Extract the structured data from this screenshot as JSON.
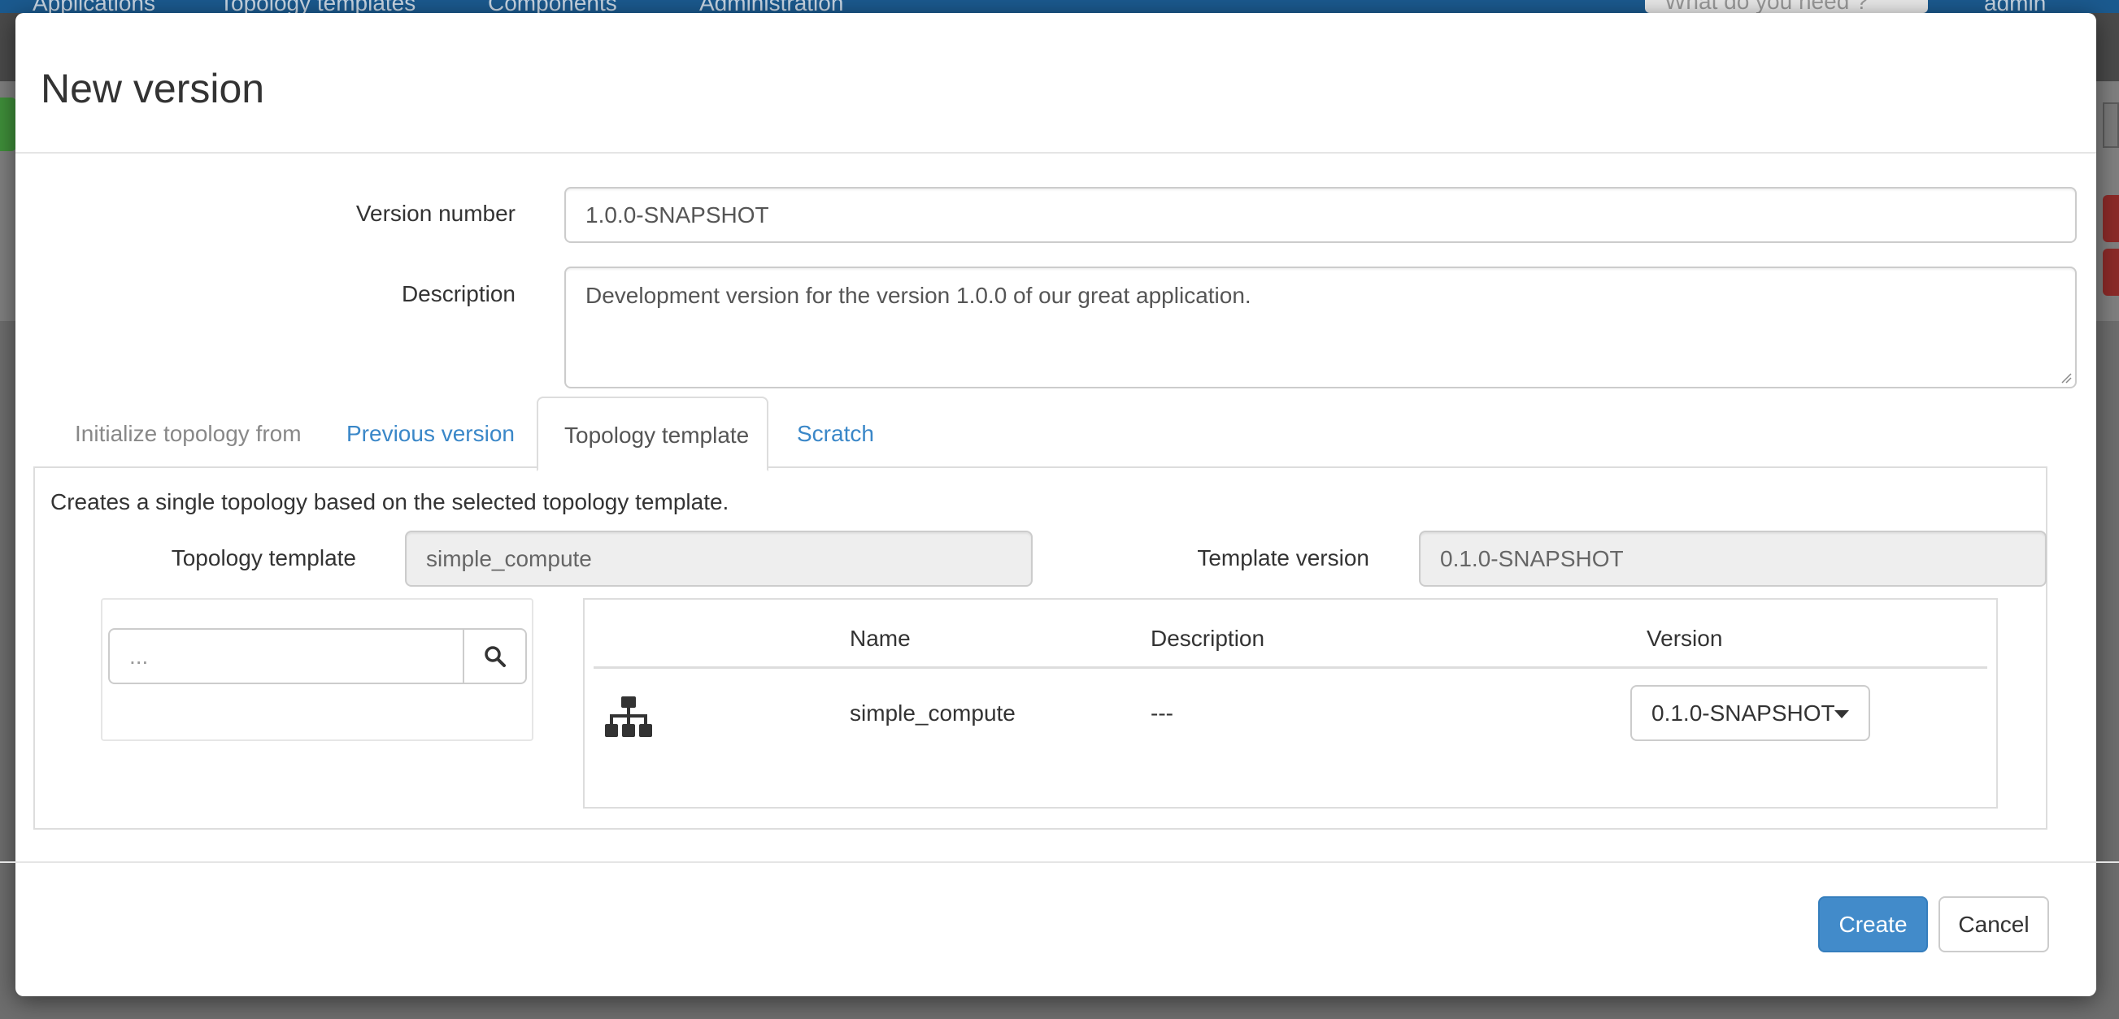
{
  "background": {
    "nav_items": [
      "Applications",
      "Topology templates",
      "Components",
      "Administration"
    ],
    "search_placeholder": "What do you need ?",
    "user_label": "admin"
  },
  "modal": {
    "title": "New version",
    "version_number": {
      "label": "Version number",
      "value": "1.0.0-SNAPSHOT"
    },
    "description": {
      "label": "Description",
      "value": "Development version for the version 1.0.0 of our great application."
    },
    "tabs": {
      "heading": "Initialize topology from",
      "items": [
        {
          "label": "Previous version",
          "active": false
        },
        {
          "label": "Topology template",
          "active": true
        },
        {
          "label": "Scratch",
          "active": false
        }
      ]
    },
    "panel": {
      "description": "Creates a single topology based on the selected topology template.",
      "topology_template": {
        "label": "Topology template",
        "value": "simple_compute"
      },
      "template_version": {
        "label": "Template version",
        "value": "0.1.0-SNAPSHOT"
      },
      "search": {
        "placeholder": "..."
      },
      "table": {
        "columns": [
          "Name",
          "Description",
          "Version"
        ],
        "rows": [
          {
            "icon": "sitemap-icon",
            "name": "simple_compute",
            "description": "---",
            "version": "0.1.0-SNAPSHOT"
          }
        ]
      }
    },
    "footer": {
      "create_label": "Create",
      "cancel_label": "Cancel"
    },
    "colors": {
      "primary": "#428bca",
      "link": "#3a87c8",
      "nav_bar": "#1b5a8f"
    }
  }
}
